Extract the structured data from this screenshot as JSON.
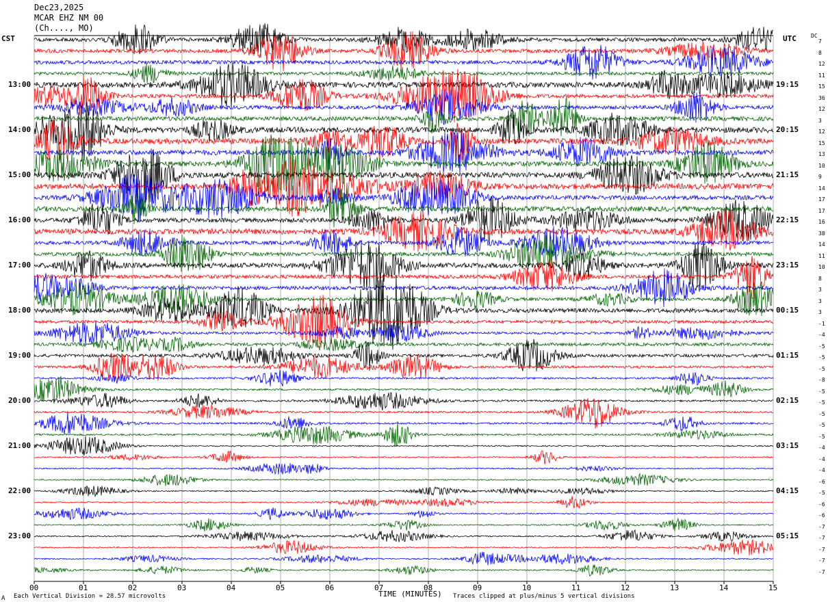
{
  "header": {
    "date": "Dec23,2025",
    "station": "MCAR EHZ NM 00",
    "location": "(Ch...., MO)"
  },
  "left_tz": "CST",
  "right_tz": "UTC",
  "dc_label": "DC",
  "footer": {
    "scale": "Each Vertical Division =   28.57 microvolts",
    "clip": "Traces clipped at plus/minus 5 vertical divisions",
    "mark": "A"
  },
  "colors": {
    "black": "#000000",
    "red": "#ff0000",
    "blue": "#0000ff",
    "green": "#006400"
  },
  "chart_data": {
    "type": "line",
    "title": "",
    "xlabel": "TIME (MINUTES)",
    "ylabel": "",
    "x_ticks": [
      "00",
      "01",
      "02",
      "03",
      "04",
      "05",
      "06",
      "07",
      "08",
      "09",
      "10",
      "11",
      "12",
      "13",
      "14",
      "15"
    ],
    "xlim": [
      0,
      15
    ],
    "trace_minutes": 15,
    "trace_color_cycle": [
      "black",
      "red",
      "blue",
      "green"
    ],
    "left_hour_labels": [
      "13:00",
      "14:00",
      "15:00",
      "16:00",
      "17:00",
      "18:00",
      "19:00",
      "20:00",
      "21:00",
      "22:00",
      "23:00"
    ],
    "right_hour_labels": [
      "19:15",
      "20:15",
      "21:15",
      "22:15",
      "23:15",
      "00:15",
      "01:15",
      "02:15",
      "03:15",
      "04:15",
      "05:15"
    ],
    "dc_offsets": [
      7,
      8,
      12,
      11,
      15,
      36,
      12,
      3,
      12,
      15,
      13,
      10,
      9,
      14,
      17,
      17,
      16,
      38,
      14,
      11,
      10,
      8,
      3,
      3,
      3,
      -1,
      -4,
      -5,
      -5,
      -5,
      -8,
      -5,
      -5,
      -5,
      -5,
      -5,
      -4,
      -4,
      -4,
      -6,
      -5,
      -6,
      -6,
      -7,
      -7,
      -7,
      -7,
      -7
    ],
    "trace_amplitude": [
      6,
      6,
      6,
      5,
      9,
      6,
      6,
      7,
      9,
      9,
      8,
      8,
      9,
      9,
      7,
      8,
      7,
      9,
      6,
      6,
      8,
      6,
      6,
      5,
      7,
      5,
      4,
      5,
      5,
      4,
      3,
      3,
      3,
      3,
      3,
      3,
      2,
      2,
      2,
      2,
      2,
      2,
      2,
      2,
      2,
      2,
      2,
      2
    ]
  }
}
